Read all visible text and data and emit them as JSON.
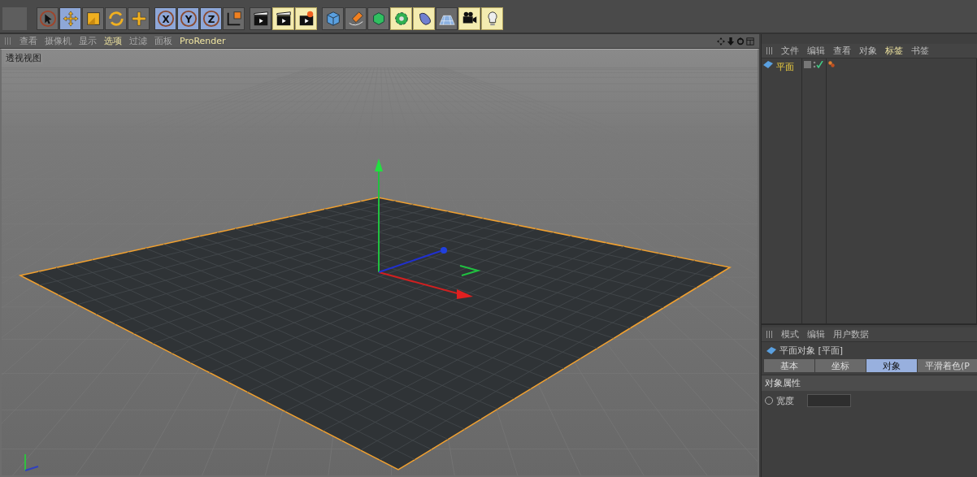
{
  "toolbar": {
    "groups": [
      {
        "tools": [
          {
            "kind": "select",
            "selected": false,
            "accent": false
          },
          {
            "kind": "move",
            "selected": true,
            "accent": false
          },
          {
            "kind": "scale",
            "selected": false,
            "accent": false
          },
          {
            "kind": "rotate",
            "selected": false,
            "accent": false
          },
          {
            "kind": "plus",
            "selected": false,
            "accent": false
          }
        ]
      },
      {
        "tools": [
          {
            "kind": "x",
            "label": "X",
            "selected": true,
            "accent": false
          },
          {
            "kind": "y",
            "label": "Y",
            "selected": true,
            "accent": false
          },
          {
            "kind": "z",
            "label": "Z",
            "selected": true,
            "accent": false
          },
          {
            "kind": "coords",
            "selected": false,
            "accent": false
          }
        ]
      },
      {
        "tools": [
          {
            "kind": "clapper",
            "selected": false,
            "accent": false
          },
          {
            "kind": "clapper",
            "selected": false,
            "accent": true
          },
          {
            "kind": "clapper-gear",
            "selected": false,
            "accent": true
          }
        ]
      },
      {
        "tools": [
          {
            "kind": "cube",
            "selected": false,
            "accent": false
          },
          {
            "kind": "pen",
            "selected": false,
            "accent": false
          },
          {
            "kind": "green-cube",
            "selected": false,
            "accent": false
          },
          {
            "kind": "flower",
            "selected": false,
            "accent": true
          },
          {
            "kind": "blob",
            "selected": false,
            "accent": true
          },
          {
            "kind": "floor",
            "selected": false,
            "accent": false
          },
          {
            "kind": "camera",
            "selected": false,
            "accent": true
          },
          {
            "kind": "bulb",
            "selected": false,
            "accent": true
          }
        ]
      }
    ]
  },
  "viewport": {
    "menu": [
      {
        "label": "查看",
        "selected": false
      },
      {
        "label": "摄像机",
        "selected": false
      },
      {
        "label": "显示",
        "selected": false
      },
      {
        "label": "选项",
        "selected": true
      },
      {
        "label": "过滤",
        "selected": false
      },
      {
        "label": "面板",
        "selected": false
      },
      {
        "label": "ProRender",
        "selected": true
      }
    ],
    "title": "透视视图"
  },
  "object_manager": {
    "menu": [
      {
        "label": "文件",
        "selected": false
      },
      {
        "label": "编辑",
        "selected": false
      },
      {
        "label": "查看",
        "selected": false
      },
      {
        "label": "对象",
        "selected": false
      },
      {
        "label": "标签",
        "selected": true
      },
      {
        "label": "书签",
        "selected": false
      }
    ],
    "objects": [
      {
        "name": "平面",
        "selected": true
      }
    ]
  },
  "attributes": {
    "menu": [
      "模式",
      "编辑",
      "用户数据"
    ],
    "object_title": "平面对象 [平面]",
    "tabs": [
      {
        "label": "基本",
        "selected": false
      },
      {
        "label": "坐标",
        "selected": false
      },
      {
        "label": "对象",
        "selected": true
      },
      {
        "label": "平滑着色(P",
        "selected": false
      }
    ],
    "section": "对象属性",
    "fields": [
      {
        "label": "宽度",
        "checked": false
      }
    ]
  }
}
